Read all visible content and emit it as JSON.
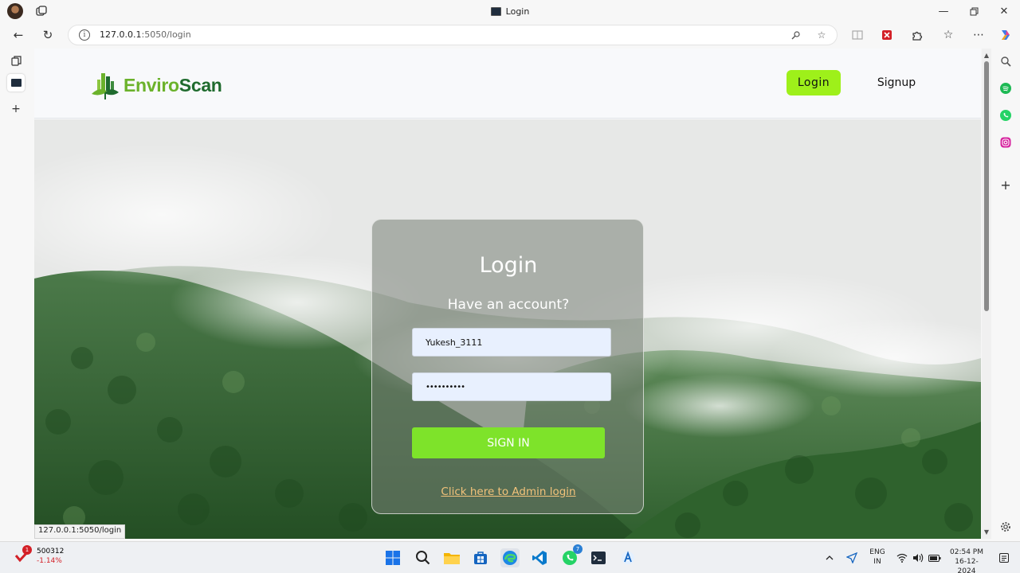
{
  "browser": {
    "tab_title": "Login",
    "url_host": "127.0.0.1",
    "url_rest": ":5050/login",
    "status_url": "127.0.0.1:5050/login"
  },
  "header": {
    "logo_part1": "Enviro",
    "logo_part2": "Scan",
    "login_label": "Login",
    "signup_label": "Signup"
  },
  "login_card": {
    "title": "Login",
    "subtitle": "Have an account?",
    "username_value": "Yukesh_3111",
    "password_value": "••••••••••",
    "signin_label": "SIGN IN",
    "admin_link": "Click here to Admin login"
  },
  "taskbar": {
    "stock_badge": "1",
    "stock_value": "500312",
    "stock_change": "-1.14%",
    "teams_badge": "7",
    "lang_line1": "ENG",
    "lang_line2": "IN",
    "time": "02:54 PM",
    "date": "16-12-2024"
  },
  "colors": {
    "accent_green": "#9ef01a",
    "signin_green": "#7ee32a",
    "logo_light_green": "#6bb22b",
    "logo_dark_green": "#1f6b2e",
    "admin_link": "#f2c27a"
  },
  "icons": {
    "browser": [
      "profile-avatar-icon",
      "workspaces-icon",
      "back-icon",
      "refresh-icon",
      "info-icon",
      "read-aloud-icon",
      "favorite-star-icon",
      "split-screen-icon",
      "extension-icon",
      "puzzle-icon",
      "favorites-icon",
      "more-icon",
      "copilot-icon"
    ],
    "sidebar_right": [
      "search-icon",
      "spotify-icon",
      "whatsapp-icon",
      "instagram-icon",
      "add-icon",
      "settings-icon"
    ],
    "taskbar": [
      "windows-start-icon",
      "search-icon",
      "file-explorer-icon",
      "store-icon",
      "edge-icon",
      "vscode-icon",
      "whatsapp-icon",
      "terminal-icon",
      "app-icon",
      "chevron-up-icon",
      "location-icon",
      "wifi-icon",
      "volume-icon",
      "battery-icon",
      "notification-icon"
    ]
  }
}
